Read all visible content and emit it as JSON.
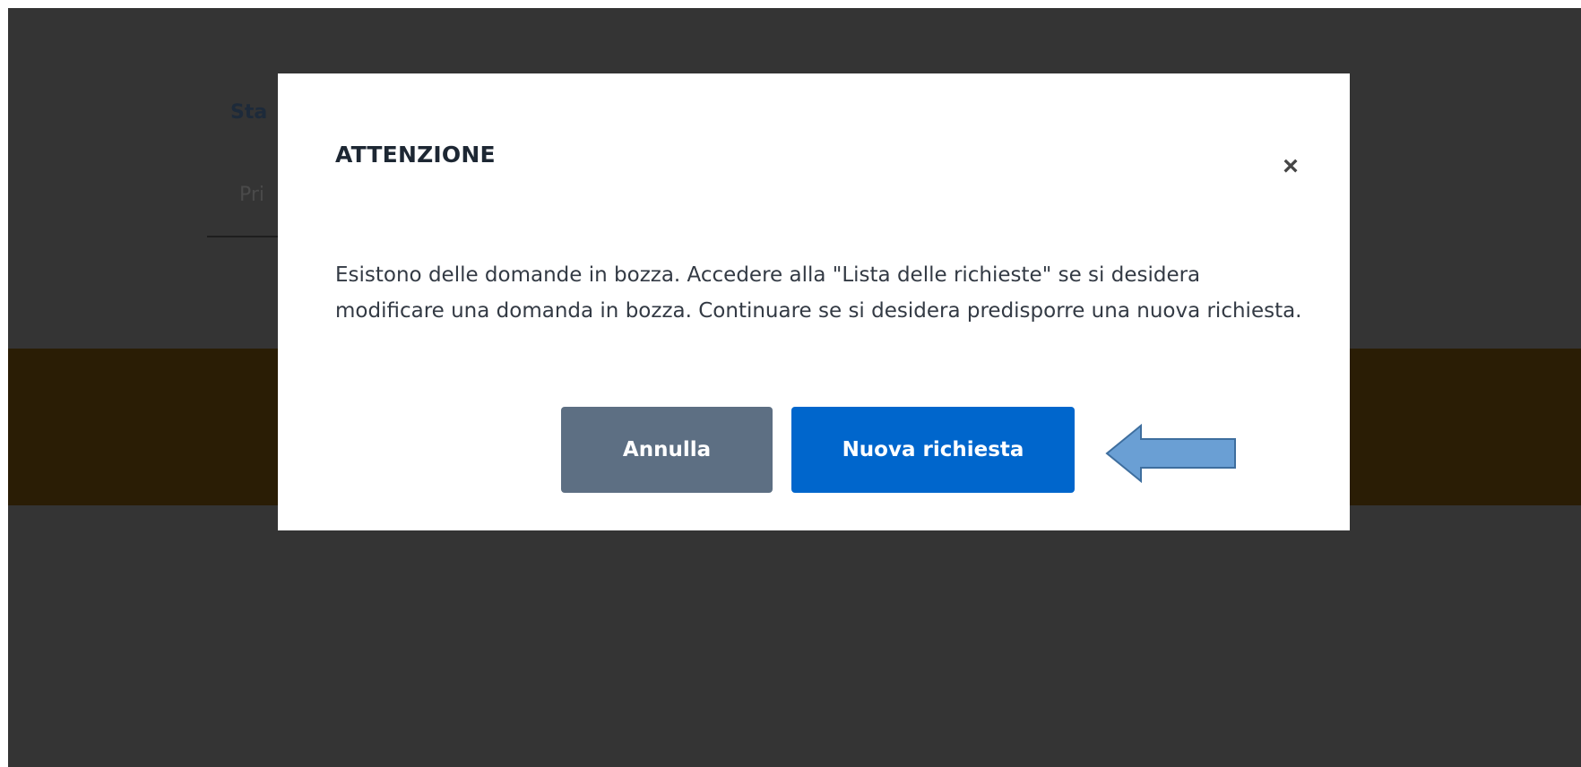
{
  "background": {
    "field_label": "Sta",
    "field_value": "Pri"
  },
  "modal": {
    "title": "ATTENZIONE",
    "close_symbol": "×",
    "message": "Esistono delle domande in bozza. Accedere alla \"Lista delle richieste\" se si desidera modificare una domanda in bozza. Continuare se si desidera predisporre una nuova richiesta.",
    "cancel_label": "Annulla",
    "new_request_label": "Nuova richiesta"
  },
  "icons": {
    "close": "close-icon",
    "annotation": "left-arrow-icon"
  },
  "colors": {
    "overlay": "#343434",
    "band": "#2a1d05",
    "cancel_button": "#5d6f83",
    "primary_button": "#0066cc",
    "annotation_arrow": "#6a9fd4"
  }
}
